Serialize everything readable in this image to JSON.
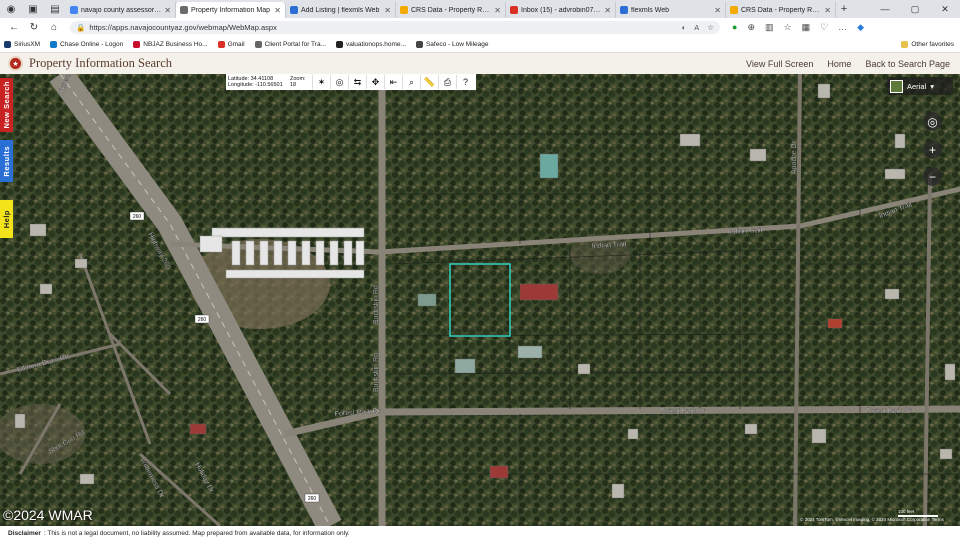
{
  "browser": {
    "tabs": [
      {
        "label": "navajo county assessor parcel",
        "color": "#4285f4"
      },
      {
        "label": "Property Information Map",
        "color": "#6b6b6b",
        "active": true
      },
      {
        "label": "Add Listing | flexmls Web",
        "color": "#2a6fd6"
      },
      {
        "label": "CRS Data - Property Report fo",
        "color": "#f2a900"
      },
      {
        "label": "Inbox (15) - advrobin07@gmai",
        "color": "#d93025"
      },
      {
        "label": "flexmls Web",
        "color": "#2a6fd6"
      },
      {
        "label": "CRS Data - Property Report fo",
        "color": "#f2a900"
      }
    ],
    "url": "https://apps.navajocountyaz.gov/webmap/WebMap.aspx",
    "bookmarks": [
      {
        "label": "SiriusXM",
        "color": "#1a3a6e"
      },
      {
        "label": "Chase Online - Logon",
        "color": "#117aca"
      },
      {
        "label": "NBJAZ Business Ho...",
        "color": "#c8102e"
      },
      {
        "label": "Gmail",
        "color": "#d93025"
      },
      {
        "label": "Client Portal for Tra...",
        "color": "#666"
      },
      {
        "label": "valuationops.home...",
        "color": "#222"
      },
      {
        "label": "Safeco - Low Mileage",
        "color": "#444"
      }
    ],
    "other_bookmarks": "Other favorites"
  },
  "app": {
    "title": "Property Information Search",
    "links": {
      "fullscreen": "View Full Screen",
      "home": "Home",
      "back": "Back to Search Page"
    }
  },
  "toolbar": {
    "latitude": "Latitude: 34.41108",
    "longitude": "Longitude: -110.56501",
    "zoom": "Zoom: 18"
  },
  "sidetabs": {
    "new_search": "New Search",
    "results": "Results",
    "help": "Help"
  },
  "map": {
    "basemap_label": "Aerial",
    "watermark": "©2024 WMAR",
    "scale": "100 feet",
    "credit": "© 2024 TomTom, ©Vexcel Imaging, © 2024 Microsoft Corporation Terms",
    "roads": {
      "hwy1": "Highway 260",
      "hwy2": "Highway 260",
      "indian1": "Indian Trail",
      "indian2": "Indian Trail",
      "indian3": "Indian Trail",
      "buckskin1": "Buckskin Rd",
      "buckskin2": "Buckskin Rd",
      "forest1": "Forest Park Dr",
      "forest2": "Forest Park Dr",
      "forest3": "Forest Park Dr",
      "elkhorn": "Elkhorn Draw Rd",
      "shotgun": "Shot Gun Rd",
      "wilderness": "Wilderness Dr",
      "holiday": "Holiday Dr",
      "apache": "Apache Dr",
      "hwy_shield1": "260",
      "hwy_shield2": "260",
      "hwy_shield3": "260"
    }
  },
  "disclaimer": {
    "label": "Disclaimer",
    "text": ": This is not a legal document, no liability assumed. Map prepared from available data, for information only."
  },
  "colors": {
    "accent_red": "#c92222",
    "accent_blue": "#2a6fd6",
    "accent_yellow": "#f2e31a",
    "parcel": "#35d0c0"
  }
}
